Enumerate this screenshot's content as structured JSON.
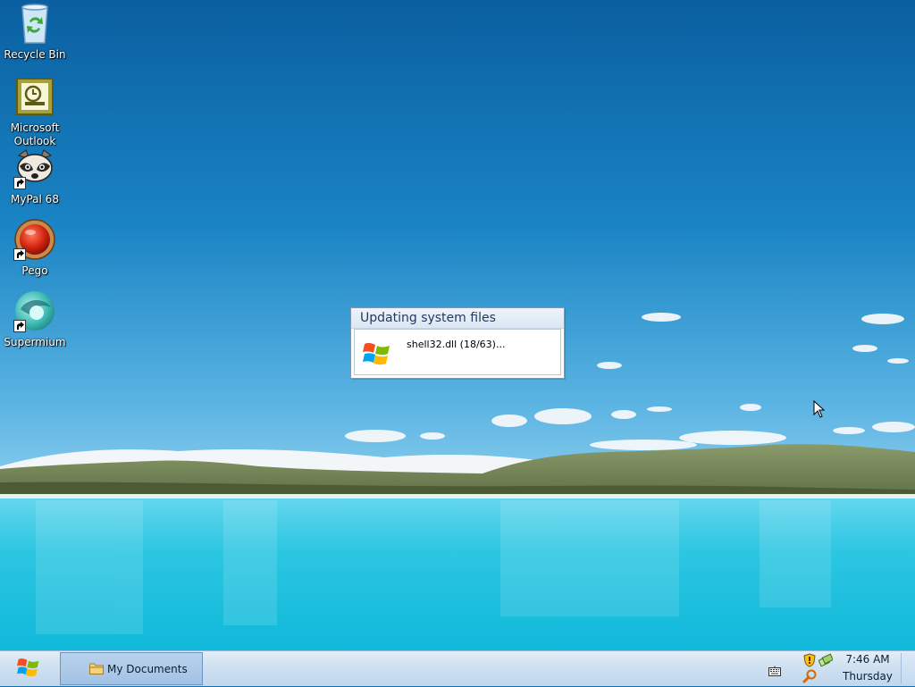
{
  "desktop": {
    "icons": [
      {
        "label": "Recycle Bin",
        "icon": "recycle-bin-icon"
      },
      {
        "label": "Microsoft Outlook",
        "icon": "outlook-icon"
      },
      {
        "label": "MyPal 68",
        "icon": "mypal-raccoon-icon"
      },
      {
        "label": "Pego",
        "icon": "pego-icon"
      },
      {
        "label": "Supermium",
        "icon": "supermium-icon"
      }
    ]
  },
  "dialog": {
    "title": "Updating system files",
    "status": "shell32.dll (18/63)...",
    "icon": "windows-flag-icon"
  },
  "taskbar": {
    "start_icon": "windows-flag-icon",
    "task_button_label": "My Documents",
    "task_button_icon": "folder-icon",
    "tray_icons": [
      "keyboard-icon",
      "security-shield-icon",
      "network-icon",
      "search-icon"
    ],
    "clock_time": "7:46 AM",
    "clock_day": "Thursday"
  },
  "colors": {
    "sky_top": "#0b67a8",
    "sky_horizon": "#7ec7ea",
    "lake": "#1fc3e0",
    "taskbar": "#cfe0f1",
    "flag_red": "#f25022",
    "flag_green": "#7fba00",
    "flag_blue": "#00a4ef",
    "flag_yellow": "#ffb900"
  }
}
